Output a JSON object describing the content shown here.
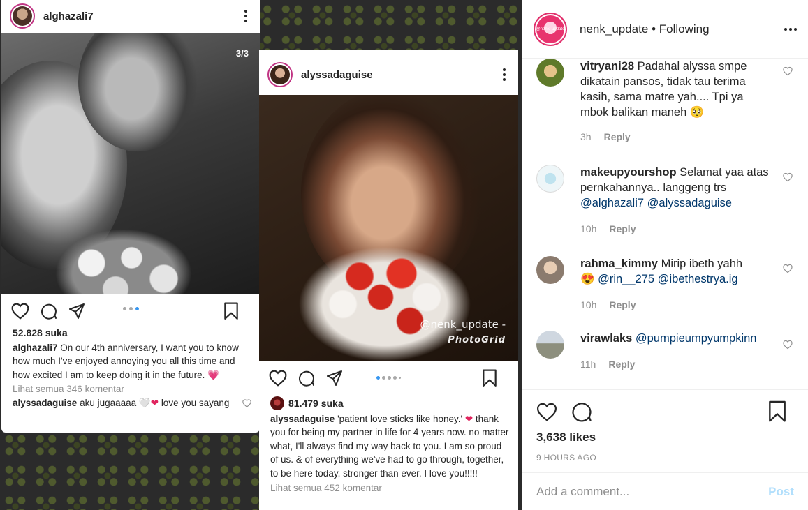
{
  "post1": {
    "username": "alghazali7",
    "counter": "3/3",
    "likes": "52.828 suka",
    "caption_user": "alghazali7",
    "caption_text": "On our 4th anniversary, I want you to know how much I've enjoyed annoying you all this time and how excited I am to keep doing it in the future.",
    "caption_emoji": "💗",
    "view_comments": "Lihat semua 346 komentar",
    "reply_user": "alyssadaguise",
    "reply_text": "aku jugaaaaa",
    "reply_glyph": "🤍",
    "reply_heart": "❤",
    "reply_tail": "love you sayang"
  },
  "post2": {
    "username": "alyssadaguise",
    "likes": "81.479 suka",
    "watermark_account": "@nenk_update -",
    "watermark_app": "PhotoGrid",
    "caption_user": "alyssadaguise",
    "caption_quote": "'patient love sticks like honey.'",
    "caption_heart": "❤",
    "caption_text": "thank you for being my partner in life for 4 years now. no matter what, I'll always find my way back to you. I am so proud of us. & of everything we've had to go through, together, to be here today, stronger than ever. I love you!!!!!",
    "view_comments": "Lihat semua 452 komentar"
  },
  "panel": {
    "username": "nenk_update",
    "separator": "•",
    "follow_status": "Following",
    "avatar_label": "@nenk_update",
    "likes": "3,638 likes",
    "timestamp": "9 HOURS AGO",
    "add_comment_placeholder": "Add a comment...",
    "post_label": "Post"
  },
  "comments": [
    {
      "user": "vitryani28",
      "text": "Padahal alyssa smpe dikatain pansos, tidak tau terima kasih, sama matre yah.... Tpi ya mbok balikan maneh",
      "emoji": "🥺",
      "time": "3h",
      "reply": "Reply"
    },
    {
      "user": "makeupyourshop",
      "text": "Selamat yaa atas pernkahannya.. langgeng trs",
      "mention1": "@alghazali7",
      "mention2": "@alyssadaguise",
      "time": "10h",
      "reply": "Reply"
    },
    {
      "user": "rahma_kimmy",
      "text": "Mirip ibeth yahh",
      "emoji": "😍",
      "mention1": "@rin__275",
      "mention2": "@ibethestrya.ig",
      "time": "10h",
      "reply": "Reply"
    },
    {
      "user": "virawlaks",
      "mention1": "@pumpieumpyumpkinn",
      "time": "11h",
      "reply": "Reply"
    }
  ],
  "colors": {
    "accent_link": "#00376b",
    "like_red": "#e0245e",
    "carousel_active": "#3897f0",
    "post_disabled": "#b2dffc"
  }
}
